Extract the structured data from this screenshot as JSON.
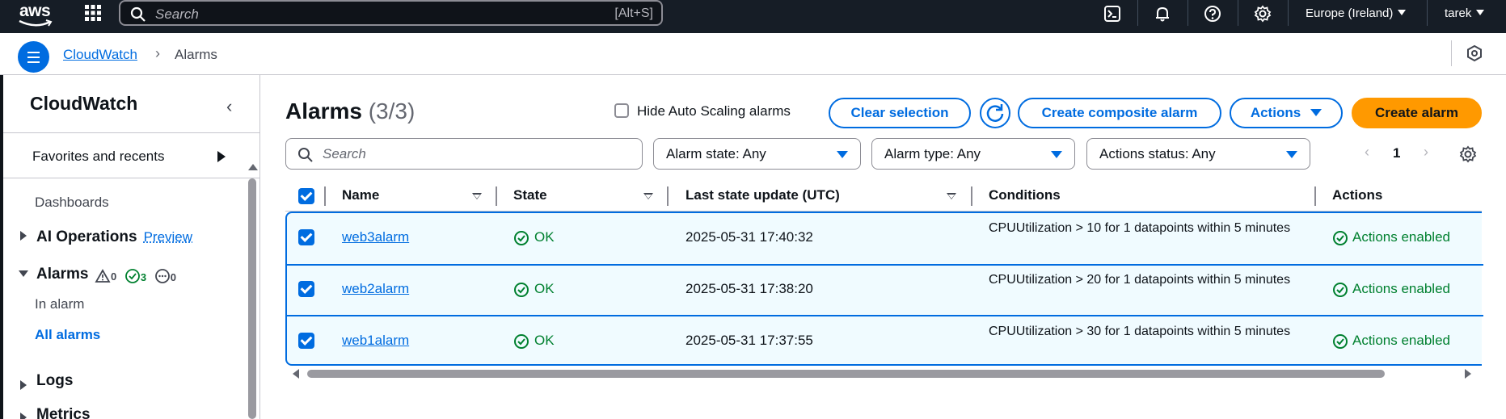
{
  "topnav": {
    "logo_text": "aws",
    "search_placeholder": "Search",
    "search_shortcut": "[Alt+S]",
    "region": "Europe (Ireland)",
    "user": "tarek",
    "icons": [
      "grid-icon",
      "search-icon",
      "cloudshell-icon",
      "bell-icon",
      "help-icon",
      "gear-icon"
    ]
  },
  "breadcrumb": {
    "root": "CloudWatch",
    "current": "Alarms"
  },
  "sidebar": {
    "title": "CloudWatch",
    "favorites": "Favorites and recents",
    "dashboards": "Dashboards",
    "ai_operations": "AI Operations",
    "preview": "Preview",
    "alarms": "Alarms",
    "alarm_counts": {
      "alarm": "0",
      "ok": "3",
      "insufficient": "0"
    },
    "in_alarm": "In alarm",
    "all_alarms": "All alarms",
    "logs": "Logs",
    "metrics": "Metrics"
  },
  "main": {
    "title": "Alarms",
    "count": "(3/3)",
    "hide_autoscaling": "Hide Auto Scaling alarms",
    "buttons": {
      "clear_selection": "Clear selection",
      "create_composite": "Create composite alarm",
      "actions": "Actions",
      "create_alarm": "Create alarm"
    },
    "search_placeholder": "Search",
    "filters": {
      "alarm_state": "Alarm state: Any",
      "alarm_type": "Alarm type: Any",
      "actions_status": "Actions status: Any"
    },
    "page": "1"
  },
  "table": {
    "columns": [
      "Name",
      "State",
      "Last state update (UTC)",
      "Conditions",
      "Actions"
    ],
    "rows": [
      {
        "name": "web3alarm",
        "state": "OK",
        "updated": "2025-05-31 17:40:32",
        "condition": "CPUUtilization > 10 for 1 datapoints within 5 minutes",
        "actions": "Actions enabled"
      },
      {
        "name": "web2alarm",
        "state": "OK",
        "updated": "2025-05-31 17:38:20",
        "condition": "CPUUtilization > 20 for 1 datapoints within 5 minutes",
        "actions": "Actions enabled"
      },
      {
        "name": "web1alarm",
        "state": "OK",
        "updated": "2025-05-31 17:37:55",
        "condition": "CPUUtilization > 30 for 1 datapoints within 5 minutes",
        "actions": "Actions enabled"
      }
    ]
  },
  "colors": {
    "nav_bg": "#161d26",
    "accent": "#006ce0",
    "primary_button": "#ff9900",
    "ok_green": "#00802f",
    "selected_row_bg": "#f0fbff"
  }
}
